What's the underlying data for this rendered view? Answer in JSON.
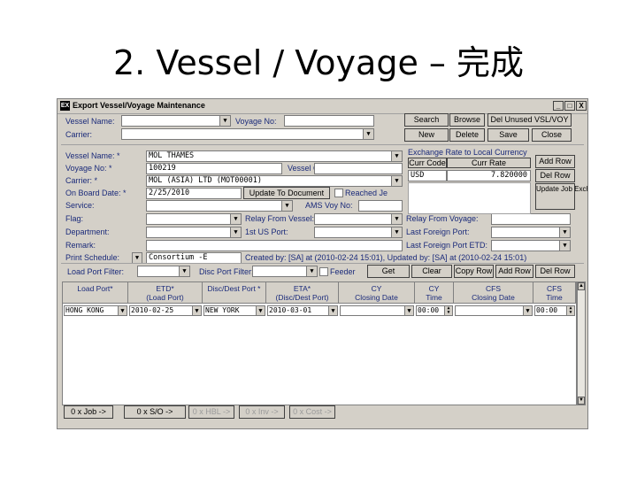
{
  "slide": {
    "title": "2. Vessel / Voyage – 完成"
  },
  "window": {
    "title": "Export Vessel/Voyage Maintenance",
    "icon_text": "EX",
    "min": "_",
    "max": "□",
    "close": "X"
  },
  "search": {
    "vessel_name_label": "Vessel Name:",
    "voyage_no_label": "Voyage No:",
    "carrier_label": "Carrier:",
    "buttons": {
      "search": "Search",
      "browse": "Browse",
      "del_unused": "Del Unused VSL/VOY",
      "new": "New",
      "delete": "Delete",
      "save": "Save",
      "close": "Close"
    }
  },
  "form": {
    "vessel_name_label": "Vessel Name: *",
    "vessel_name": "MOL THAMES",
    "voyage_no_label": "Voyage No: *",
    "voyage_no": "100219",
    "vessel_code_label": "Vessel Code:",
    "carrier_label": "Carrier: *",
    "carrier": "MOL (ASIA) LTD (MOT00001)",
    "on_board_label": "On Board Date: *",
    "on_board": "2/25/2010",
    "update_doc": "Update To Document",
    "reached_label": "Reached Je",
    "service_label": "Service:",
    "ams_label": "AMS Voy No:",
    "flag_label": "Flag:",
    "relay_vessel_label": "Relay From Vessel:",
    "relay_voyage_label": "Relay From Voyage:",
    "department_label": "Department:",
    "first_us_label": "1st US Port:",
    "last_foreign_label": "Last Foreign Port:",
    "remark_label": "Remark:",
    "last_foreign_etd_label": "Last Foreign Port ETD:",
    "print_schedule_label": "Print Schedule:",
    "print_schedule": "Consortium -E",
    "created_text": "Created by: [SA] at (2010-02-24 15:01), Updated by: [SA] at (2010-02-24 15:01)"
  },
  "exchange": {
    "title": "Exchange Rate to Local Currency",
    "curr_code_label": "Curr Code",
    "curr_rate_label": "Curr Rate",
    "curr_code": "USD",
    "curr_rate": "7.820000",
    "add_row": "Add Row",
    "del_row": "Del Row",
    "update_job": "Update Job Exchange Rate"
  },
  "filters": {
    "load_port_filter": "Load Port Filter:",
    "disc_port_filter": "Disc Port Filter:",
    "feeder": "Feeder",
    "get": "Get",
    "clear": "Clear",
    "copy_row": "Copy Row",
    "add_row": "Add Row",
    "del_row": "Del Row"
  },
  "grid": {
    "columns": [
      "Load Port*",
      "ETD*\n(Load Port)",
      "Disc/Dest Port *",
      "ETA*\n(Disc/Dest Port)",
      "CY\nClosing Date",
      "CY\nTime",
      "CFS\nClosing Date",
      "CFS\nTime"
    ],
    "row": {
      "load_port": "HONG KONG",
      "etd": "2010-02-25",
      "dest_port": "NEW YORK",
      "eta": "2010-03-01",
      "cy_date": "",
      "cy_time": "00:00",
      "cfs_date": "",
      "cfs_time": "00:00"
    }
  },
  "footer": {
    "job": "0 x Job ->",
    "so": "0 x S/O ->",
    "hbl": "0 x HBL ->",
    "inv": "0 x Inv ->",
    "cost": "0 x Cost ->"
  }
}
